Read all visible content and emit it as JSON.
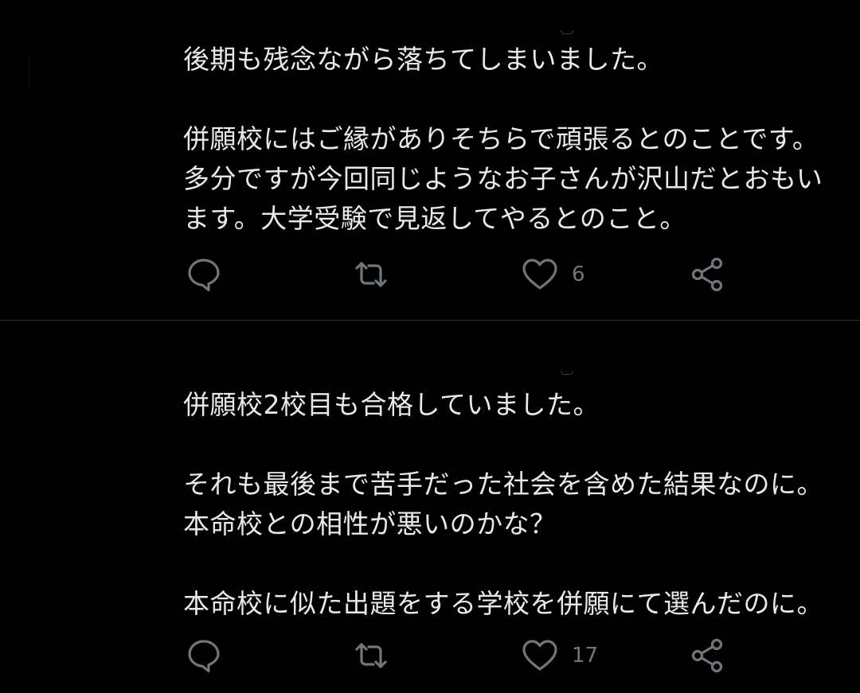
{
  "theme": {
    "background": "#000000",
    "text_color": "#e7e9ea",
    "icon_color": "#71767b",
    "divider_color": "#2f3336"
  },
  "tweets": [
    {
      "paragraphs": [
        [
          "後期も残念ながら落ちてしまいました。"
        ],
        [
          "併願校にはご縁がありそちらで頑張るとのことです。",
          "多分ですが今回同じようなお子さんが沢山だとおもい",
          "ます。大学受験で見返してやるとのこと。"
        ]
      ],
      "actions": {
        "reply_icon": "reply-icon",
        "retweet_icon": "retweet-icon",
        "like_icon": "heart-icon",
        "like_count": "6",
        "share_icon": "share-icon"
      }
    },
    {
      "paragraphs": [
        [
          "併願校2校目も合格していました。"
        ],
        [
          "それも最後まで苦手だった社会を含めた結果なのに。",
          "本命校との相性が悪いのかな？"
        ],
        [
          "本命校に似た出題をする学校を併願にて選んだのに。"
        ]
      ],
      "actions": {
        "reply_icon": "reply-icon",
        "retweet_icon": "retweet-icon",
        "like_icon": "heart-icon",
        "like_count": "17",
        "share_icon": "share-icon"
      }
    }
  ]
}
